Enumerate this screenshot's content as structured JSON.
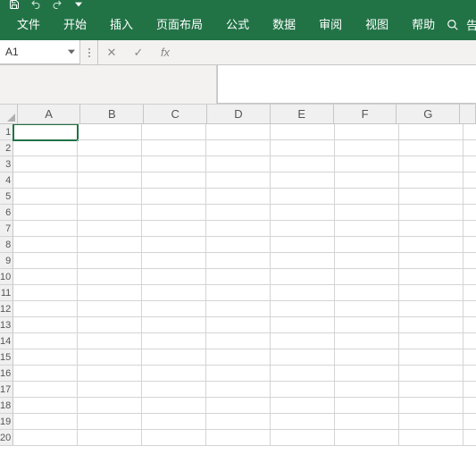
{
  "ribbon": {
    "tabs": {
      "file": "文件",
      "home": "开始",
      "insert": "插入",
      "layout": "页面布局",
      "formulas": "公式",
      "data": "数据",
      "review": "审阅",
      "view": "视图",
      "help": "帮助"
    },
    "tellme": "告"
  },
  "namebox": {
    "value": "A1"
  },
  "formula_bar": {
    "cancel": "✕",
    "confirm": "✓",
    "fx": "fx",
    "value": ""
  },
  "columns": [
    "A",
    "B",
    "C",
    "D",
    "E",
    "F",
    "G"
  ],
  "rows": [
    "1",
    "2",
    "3",
    "4",
    "5",
    "6",
    "7",
    "8",
    "9",
    "10",
    "11",
    "12",
    "13",
    "14",
    "15",
    "16",
    "17",
    "18",
    "19",
    "20"
  ],
  "accent_color": "#217346",
  "active_cell": "A1"
}
